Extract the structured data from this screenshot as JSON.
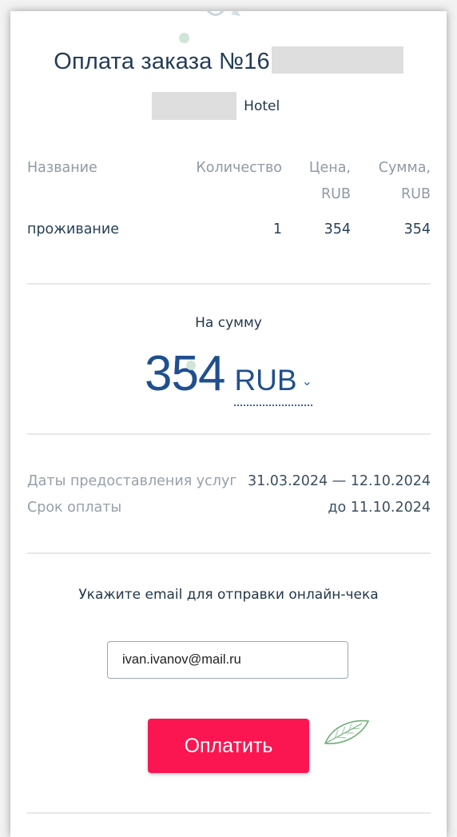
{
  "order": {
    "title_prefix": "Оплата заказа №16",
    "hotel_suffix": "Hotel"
  },
  "table": {
    "headers": {
      "name": "Название",
      "quantity": "Количество",
      "price_line1": "Цена,",
      "price_line2": "RUB",
      "total_line1": "Сумма,",
      "total_line2": "RUB"
    },
    "rows": [
      {
        "name": "проживание",
        "quantity": "1",
        "price": "354",
        "total": "354"
      }
    ]
  },
  "summary": {
    "label": "На сумму",
    "amount": "354",
    "currency": "RUB"
  },
  "details": {
    "service_dates_label": "Даты предоставления услуг",
    "service_dates_value": "31.03.2024 — 12.10.2024",
    "due_label": "Срок оплаты",
    "due_value": "до 11.10.2024"
  },
  "email": {
    "label": "Укажите email для отправки онлайн-чека",
    "value": "ivan.ivanov@mail.ru"
  },
  "pay_button": {
    "label": "Оплатить"
  },
  "colors": {
    "accent_button": "#fb1651",
    "amount_blue": "#1f4f8f",
    "title_navy": "#233c58"
  },
  "icons": [
    "decorative-top-icon",
    "leaf-icon",
    "chevron-down-icon"
  ]
}
